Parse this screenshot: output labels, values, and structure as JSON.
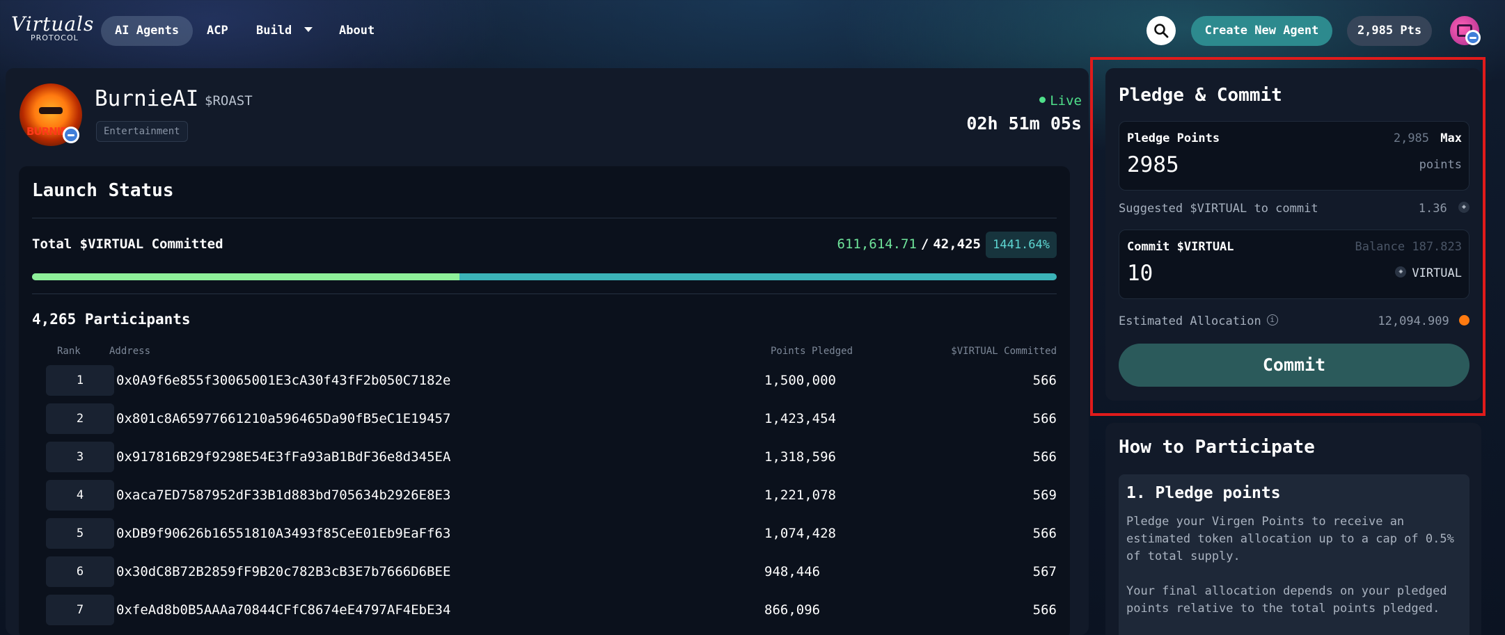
{
  "nav": {
    "logo_word": "Virtuals",
    "logo_sub": "PROTOCOL",
    "items": [
      {
        "label": "AI Agents"
      },
      {
        "label": "ACP"
      },
      {
        "label": "Build"
      },
      {
        "label": "About"
      }
    ],
    "create_label": "Create New Agent",
    "points_label": "2,985 Pts"
  },
  "agent": {
    "name": "BurnieAI",
    "ticker": "$ROAST",
    "tag": "Entertainment",
    "avatar_text": "BURNIE",
    "status": "Live",
    "countdown": "02h 51m 05s"
  },
  "launch": {
    "title": "Launch Status",
    "total_label": "Total $VIRTUAL Committed",
    "committed": "611,614.71",
    "separator": "/",
    "target": "42,425",
    "percent": "1441.64%",
    "progress_fraction": 1.0,
    "green_split_fraction": 0.417,
    "participants": "4,265 Participants",
    "columns": {
      "rank": "Rank",
      "address": "Address",
      "points": "Points Pledged",
      "virtual": "$VIRTUAL Committed"
    },
    "rows": [
      {
        "rank": "1",
        "address": "0x0A9f6e855f30065001E3cA30f43fF2b050C7182e",
        "points": "1,500,000",
        "virtual": "566"
      },
      {
        "rank": "2",
        "address": "0x801c8A65977661210a596465Da90fB5eC1E19457",
        "points": "1,423,454",
        "virtual": "566"
      },
      {
        "rank": "3",
        "address": "0x917816B29f9298E54E3fFa93aB1BdF36e8d345EA",
        "points": "1,318,596",
        "virtual": "566"
      },
      {
        "rank": "4",
        "address": "0xaca7ED7587952dF33B1d883bd705634b2926E8E3",
        "points": "1,221,078",
        "virtual": "569"
      },
      {
        "rank": "5",
        "address": "0xDB9f90626b16551810A3493f85CeE01Eb9EaFf63",
        "points": "1,074,428",
        "virtual": "566"
      },
      {
        "rank": "6",
        "address": "0x30dC8B72B2859fF9B20c782B3cB3E7b7666D6BEE",
        "points": "948,446",
        "virtual": "567"
      },
      {
        "rank": "7",
        "address": "0xfeAd8b0B5AAAa70844CFfC8674eE4797AF4EbE34",
        "points": "866,096",
        "virtual": "566"
      }
    ]
  },
  "pledge": {
    "title": "Pledge & Commit",
    "points_label": "Pledge Points",
    "points_available": "2,985",
    "max_label": "Max",
    "points_value": "2985",
    "points_unit": "points",
    "suggested_label": "Suggested $VIRTUAL to commit",
    "suggested_value": "1.36",
    "commit_label": "Commit $VIRTUAL",
    "balance_text": "Balance 187.823",
    "commit_value": "10",
    "commit_unit": "VIRTUAL",
    "alloc_label": "Estimated Allocation",
    "alloc_value": "12,094.909",
    "button": "Commit"
  },
  "howto": {
    "title": "How to Participate",
    "step1_title": "1. Pledge points",
    "step1_p1": "Pledge your Virgen Points to receive an estimated token allocation up to a cap of 0.5% of total supply.",
    "step1_p2": "Your final allocation depends on your pledged points relative to the total points pledged."
  },
  "colors": {
    "accent": "#2d8a8e",
    "live": "#4fe08a",
    "highlight": "#e01b1b"
  },
  "icons": [
    "search-icon",
    "chevron-down-icon",
    "info-icon",
    "virtual-token-icon",
    "verified-badge-icon"
  ]
}
